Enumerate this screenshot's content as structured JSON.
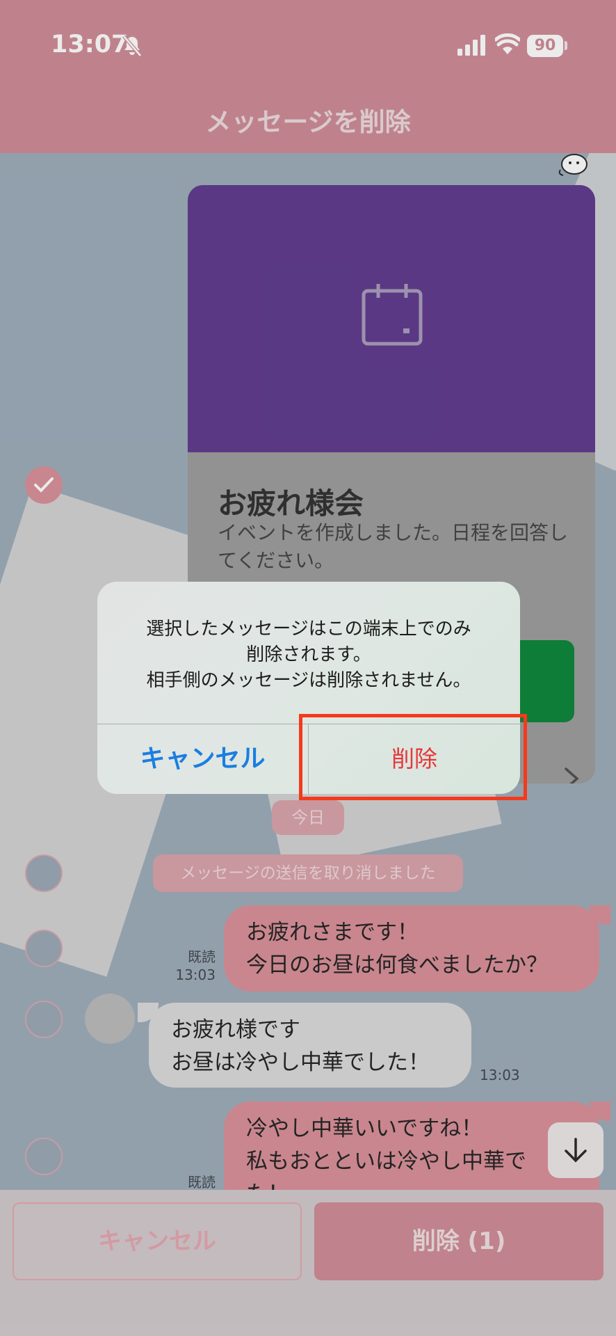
{
  "status_bar": {
    "time": "13:07",
    "battery": "90"
  },
  "header": {
    "title": "メッセージを削除"
  },
  "event_card": {
    "title": "お疲れ様会",
    "description": "イベントを作成しました。日程を回答してください。"
  },
  "chat": {
    "today_label": "今日",
    "unsend_notice": "メッセージの送信を取り消しました",
    "messages": [
      {
        "from": "me",
        "line1": "お疲れさまです！",
        "line2": "今日のお昼は何食べましたか？",
        "read": "既読",
        "time": "13:03"
      },
      {
        "from": "them",
        "line1": "お疲れ様です",
        "line2": "お昼は冷やし中華でした！",
        "time": "13:03"
      },
      {
        "from": "me",
        "line1": "冷やし中華いいですね！",
        "line2": "私もおとといは冷やし中華で",
        "line3": "た！",
        "read": "既読"
      }
    ]
  },
  "dialog": {
    "message_line1": "選択したメッセージはこの端末上でのみ",
    "message_line2": "削除されます。",
    "message_line3": "相手側のメッセージは削除されません。",
    "cancel_label": "キャンセル",
    "delete_label": "削除"
  },
  "bottom_bar": {
    "cancel_label": "キャンセル",
    "delete_label": "削除 (1)"
  },
  "colors": {
    "header": "#cd8893",
    "event_purple": "#5a348a",
    "event_green": "#048233",
    "alert_cancel": "#1a7ee0",
    "alert_delete": "#e8363a",
    "highlight": "#f43a1c"
  },
  "icons": [
    "bell-off-icon",
    "signal-icon",
    "wifi-icon",
    "battery-icon",
    "calendar-icon",
    "check-icon",
    "chevron-right-icon",
    "arrow-down-icon"
  ]
}
